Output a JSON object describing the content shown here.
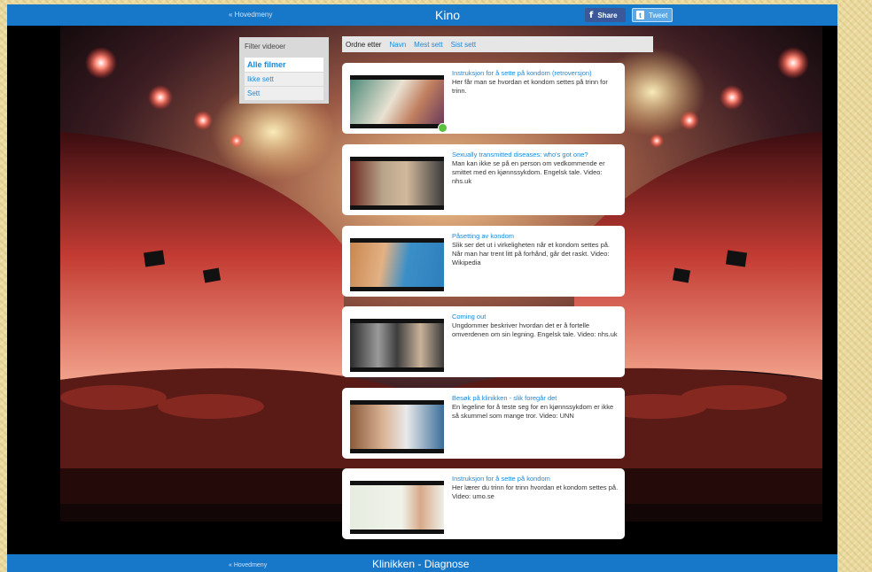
{
  "header": {
    "back_link": "« Hovedmeny",
    "title": "Kino",
    "share_label": "Share",
    "tweet_label": "Tweet"
  },
  "filter": {
    "title": "Filter videoer",
    "items": [
      "Alle filmer",
      "Ikke sett",
      "Sett"
    ]
  },
  "sort": {
    "label": "Ordne etter",
    "options": [
      "Navn",
      "Mest sett",
      "Sist sett"
    ]
  },
  "videos": [
    {
      "title": "Instruksjon for å sette på kondom (retroversjon)",
      "description": "Her får man se hvordan et kondom settes på trinn for trinn.",
      "watched": true
    },
    {
      "title": "Sexually transmitted diseases: who's got one?",
      "description": "Man kan ikke se på en person om vedkommende er smittet med en kjønnssykdom. Engelsk tale. Video: nhs.uk",
      "watched": false
    },
    {
      "title": "Påsetting av kondom",
      "description": "Slik ser det ut i virkeligheten når et kondom settes på. Når man har trent litt på forhånd, går det raskt. Video: Wikipedia",
      "watched": false
    },
    {
      "title": "Coming out",
      "description": "Ungdommer beskriver hvordan det er å fortelle omverdenen om sin legning. Engelsk tale. Video: nhs.uk",
      "watched": false
    },
    {
      "title": "Besøk på klinikken - slik foregår det",
      "description": "En legeline for å teste seg for en kjønnssykdom er ikke så skummel som mange tror. Video: UNN",
      "watched": false
    },
    {
      "title": "Instruksjon for å sette på kondom",
      "description": "Her lærer du trinn for trinn hvordan et kondom settes på. Video: umo.se",
      "watched": false
    }
  ],
  "footer": {
    "back_link": "« Hovedmeny",
    "title": "Klinikken - Diagnose"
  },
  "colors": {
    "bar_blue": "#1777c9",
    "link_blue": "#1a8ad8",
    "watched_green": "#59c13d"
  }
}
